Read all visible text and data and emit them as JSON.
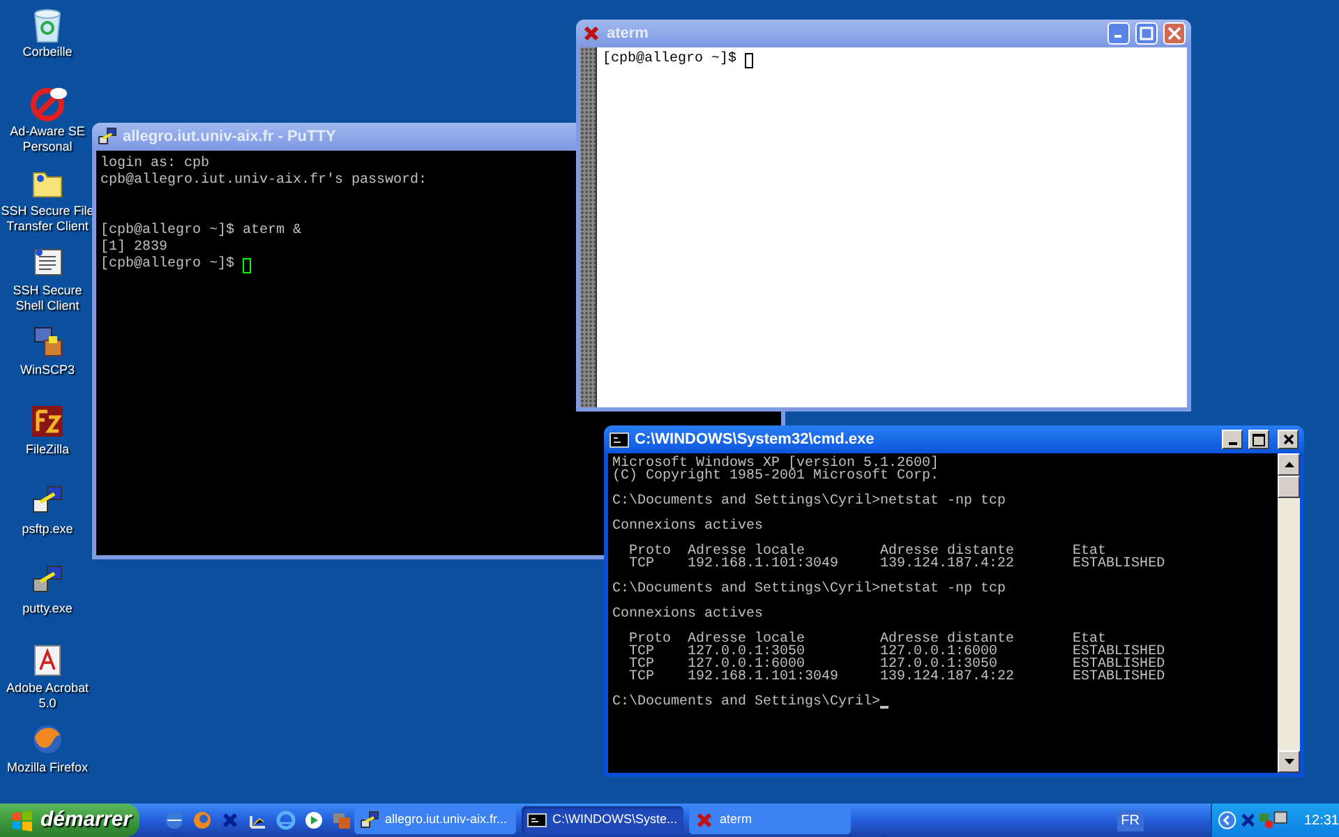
{
  "desktop_icons": [
    {
      "label": "Corbeille"
    },
    {
      "label": "Ad-Aware SE Personal"
    },
    {
      "label": "SSH Secure File Transfer Client"
    },
    {
      "label": "SSH Secure Shell Client"
    },
    {
      "label": "WinSCP3"
    },
    {
      "label": "FileZilla"
    },
    {
      "label": "psftp.exe"
    },
    {
      "label": "putty.exe"
    },
    {
      "label": "Adobe Acrobat 5.0"
    },
    {
      "label": "Mozilla Firefox"
    }
  ],
  "windows": [
    {
      "kind": "putty",
      "title": "allegro.iut.univ-aix.fr - PuTTY",
      "active": false,
      "cursor": true,
      "blocks": [
        [
          "login as: cpb",
          "cpb@allegro.iut.univ-aix.fr's password:"
        ],
        [
          "[cpb@allegro ~]$ aterm &",
          "[1] 2839",
          "[cpb@allegro ~]$ "
        ]
      ]
    },
    {
      "kind": "aterm",
      "title": "aterm",
      "active": false,
      "cursor": true,
      "blocks": [
        [
          "[cpb@allegro ~]$ "
        ]
      ]
    },
    {
      "kind": "cmd",
      "title": "C:\\WINDOWS\\System32\\cmd.exe",
      "active": true,
      "cursor": true,
      "blocks": [
        [
          "Microsoft Windows XP [version 5.1.2600]",
          "(C) Copyright 1985-2001 Microsoft Corp."
        ],
        [
          "C:\\Documents and Settings\\Cyril>netstat -np tcp"
        ],
        [
          "Connexions actives"
        ],
        [
          "  Proto  Adresse locale         Adresse distante       Etat",
          "  TCP    192.168.1.101:3049     139.124.187.4:22       ESTABLISHED"
        ],
        [
          "C:\\Documents and Settings\\Cyril>netstat -np tcp"
        ],
        [
          "Connexions actives"
        ],
        [
          "  Proto  Adresse locale         Adresse distante       Etat",
          "  TCP    127.0.0.1:3050         127.0.0.1:6000         ESTABLISHED",
          "  TCP    127.0.0.1:6000         127.0.0.1:3050         ESTABLISHED",
          "  TCP    192.168.1.101:3049     139.124.187.4:22       ESTABLISHED"
        ],
        [
          "C:\\Documents and Settings\\Cyril>"
        ]
      ]
    }
  ],
  "taskbar": {
    "start": "démarrer",
    "tasks": [
      {
        "label": "allegro.iut.univ-aix.fr...",
        "selected": false
      },
      {
        "label": "C:\\WINDOWS\\Syste...",
        "selected": true
      },
      {
        "label": "aterm",
        "selected": false
      }
    ],
    "language": "FR",
    "clock": "12:31"
  }
}
